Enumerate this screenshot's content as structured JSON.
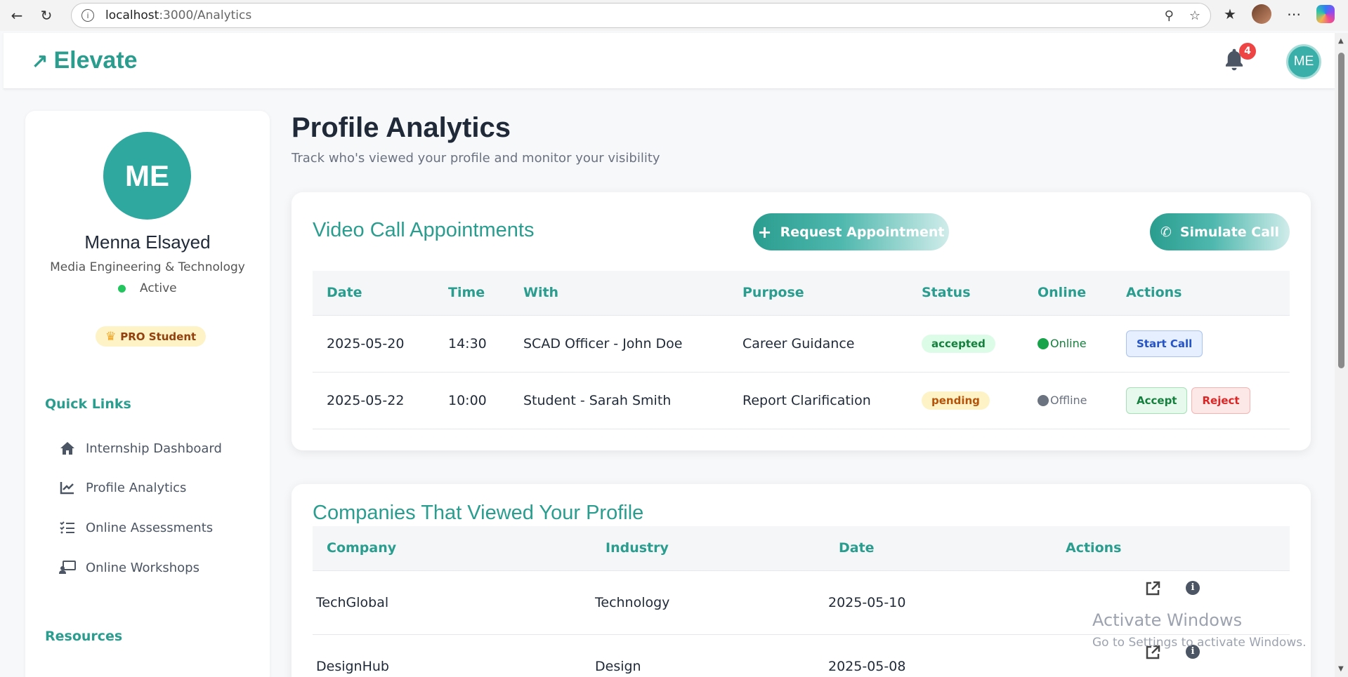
{
  "browser": {
    "url_host": "localhost",
    "url_path": ":3000/Analytics"
  },
  "header": {
    "logo_text": "Elevate",
    "notification_count": "4",
    "avatar_initials": "ME"
  },
  "sidebar": {
    "avatar_initials": "ME",
    "name": "Menna Elsayed",
    "major": "Media Engineering & Technology",
    "status": "Active",
    "badge": "PRO Student",
    "quick_links_title": "Quick Links",
    "links": [
      {
        "label": "Internship Dashboard",
        "icon": "home-icon"
      },
      {
        "label": "Profile Analytics",
        "icon": "chart-line-icon"
      },
      {
        "label": "Online Assessments",
        "icon": "checklist-icon"
      },
      {
        "label": "Online Workshops",
        "icon": "presentation-icon"
      }
    ],
    "resources_title": "Resources"
  },
  "main": {
    "title": "Profile Analytics",
    "subtitle": "Track who's viewed your profile and monitor your visibility"
  },
  "appointments": {
    "title": "Video Call Appointments",
    "request_button": "Request Appointment",
    "simulate_button": "Simulate Call",
    "columns": [
      "Date",
      "Time",
      "With",
      "Purpose",
      "Status",
      "Online",
      "Actions"
    ],
    "rows": [
      {
        "date": "2025-05-20",
        "time": "14:30",
        "with": "SCAD Officer - John Doe",
        "purpose": "Career Guidance",
        "status": "accepted",
        "online": "Online",
        "actions": [
          "Start Call"
        ]
      },
      {
        "date": "2025-05-22",
        "time": "10:00",
        "with": "Student - Sarah Smith",
        "purpose": "Report Clarification",
        "status": "pending",
        "online": "Offline",
        "actions": [
          "Accept",
          "Reject"
        ]
      }
    ]
  },
  "companies": {
    "title": "Companies That Viewed Your Profile",
    "columns": [
      "Company",
      "Industry",
      "Date",
      "Actions"
    ],
    "rows": [
      {
        "company": "TechGlobal",
        "industry": "Technology",
        "date": "2025-05-10"
      },
      {
        "company": "DesignHub",
        "industry": "Design",
        "date": "2025-05-08"
      }
    ]
  },
  "watermark": {
    "line1": "Activate Windows",
    "line2": "Go to Settings to activate Windows."
  },
  "colors": {
    "accent": "#2a9d8f",
    "badge_red": "#ef4444"
  }
}
